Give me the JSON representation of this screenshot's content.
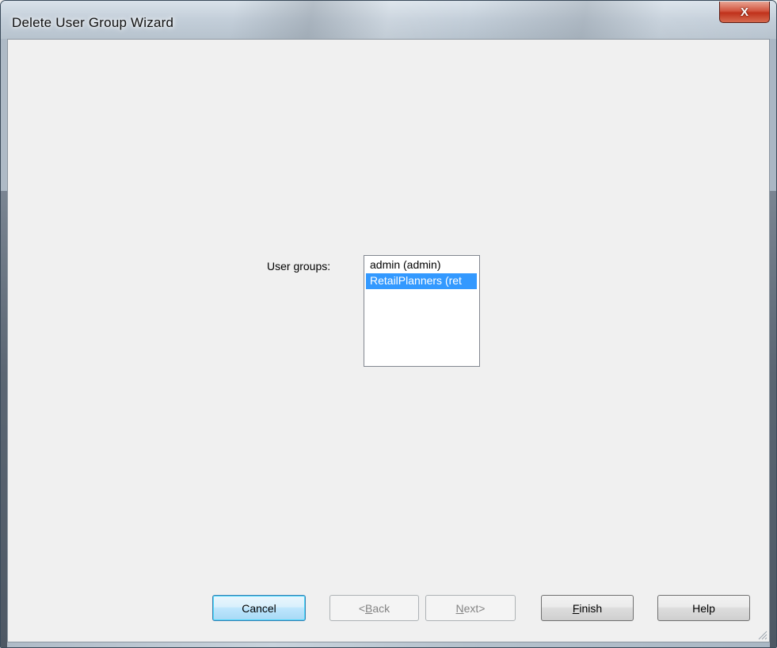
{
  "window": {
    "title": "Delete User Group Wizard",
    "close_label": "X"
  },
  "form": {
    "user_groups_label": "User groups:",
    "user_groups": [
      {
        "label": "admin (admin)",
        "selected": false
      },
      {
        "label": "RetailPlanners (ret",
        "selected": true
      }
    ]
  },
  "buttons": {
    "cancel": "Cancel",
    "back_prefix": "<",
    "back_mnemonic": "B",
    "back_rest": "ack",
    "next_mnemonic": "N",
    "next_rest": "ext>",
    "finish_mnemonic": "F",
    "finish_rest": "inish",
    "help": "Help"
  },
  "colors": {
    "selection": "#3399ff",
    "close_button": "#c0321c"
  }
}
